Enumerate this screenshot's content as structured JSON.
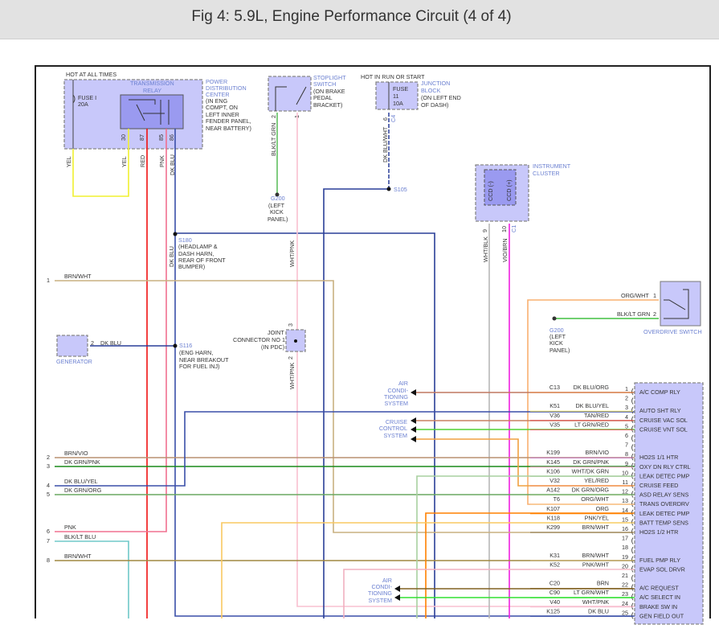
{
  "title": "Fig 4: 5.9L, Engine Performance Circuit (4 of 4)",
  "pdc": {
    "hot": "HOT AT ALL TIMES",
    "relay": [
      "TRANSMISSION",
      "RELAY"
    ],
    "fuse": [
      "FUSE I",
      "20A"
    ],
    "name": [
      "POWER",
      "DISTRIBUTION",
      "CENTER",
      "(IN ENG",
      "COMPT, ON",
      "LEFT INNER",
      "FENDER PANEL,",
      "NEAR BATTERY)"
    ],
    "pins": [
      "30",
      "87",
      "85",
      "86"
    ],
    "wires": [
      "YEL",
      "YEL",
      "RED",
      "PNK",
      "DK BLU"
    ]
  },
  "stoplight": {
    "name": [
      "STOPLIGHT",
      "SWITCH",
      "(ON BRAKE",
      "PEDAL",
      "BRACKET)"
    ],
    "pins": [
      "2",
      "1"
    ],
    "wires": [
      "BLK/LT GRN",
      "WHT/PNK"
    ],
    "ground": [
      "G200",
      "(LEFT",
      "KICK",
      "PANEL)"
    ]
  },
  "junction": {
    "hot": "HOT IN RUN OR START",
    "fuse": [
      "FUSE",
      "11",
      "10A"
    ],
    "name": [
      "JUNCTION",
      "BLOCK",
      "(ON LEFT END",
      "OF DASH)"
    ],
    "pin": "6",
    "conn": "C4",
    "wire": "DK BLU/WHT",
    "splice": "S105"
  },
  "cluster": {
    "name": [
      "INSTRUMENT",
      "CLUSTER"
    ],
    "ccd": [
      "CCD (-)",
      "CCD (+)"
    ],
    "pins": [
      "9",
      "10"
    ],
    "conn": "C1",
    "wires": [
      "WHT/BLK",
      "VIO/BRN"
    ]
  },
  "s180": {
    "name": [
      "S180",
      "(HEADLAMP &",
      "DASH HARN,",
      "REAR OF FRONT",
      "BUMPER)"
    ],
    "wire": "DK BLU"
  },
  "s116": {
    "name": [
      "S116",
      "(ENG HARN,",
      "NEAR BREAKOUT",
      "FOR FUEL INJ)"
    ]
  },
  "generator": {
    "name": "GENERATOR",
    "pin": "2",
    "wire": "DK BLU"
  },
  "joint": {
    "name": [
      "JOINT",
      "CONNECTOR NO 1",
      "(IN PDC)"
    ],
    "pins": [
      "3",
      "2"
    ],
    "wire": "WHT/PNK"
  },
  "overdrive": {
    "name": "OVERDRIVE SWITCH",
    "wires": [
      {
        "pin": "1",
        "label": "ORG/WHT"
      },
      {
        "pin": "2",
        "label": "BLK/LT GRN"
      }
    ],
    "ground": [
      "G200",
      "(LEFT",
      "KICK",
      "PANEL)"
    ]
  },
  "systems": {
    "ac1": [
      "AIR",
      "CONDI-",
      "TIONING",
      "SYSTEM"
    ],
    "cruise": [
      "CRUISE",
      "CONTROL",
      "SYSTEM"
    ],
    "ac2": [
      "AIR",
      "CONDI-",
      "TIONING",
      "SYSTEM"
    ]
  },
  "left_pins": [
    {
      "pin": "1",
      "label": "BRN/WHT"
    },
    {
      "pin": "2",
      "label": "BRN/VIO"
    },
    {
      "pin": "3",
      "label": "DK GRN/PNK"
    },
    {
      "pin": "4",
      "label": "DK BLU/YEL"
    },
    {
      "pin": "5",
      "label": "DK GRN/ORG"
    },
    {
      "pin": "6",
      "label": "PNK"
    },
    {
      "pin": "7",
      "label": "BLK/LT BLU"
    },
    {
      "pin": "8",
      "label": "BRN/WHT"
    }
  ],
  "pcm_pins": [
    {
      "pin": "1",
      "circuit": "C13",
      "wire": "DK BLU/ORG",
      "func": "A/C COMP RLY",
      "colors": [
        "#3a4fa8",
        "#e07a30"
      ]
    },
    {
      "pin": "2",
      "circuit": "",
      "wire": "",
      "func": ""
    },
    {
      "pin": "3",
      "circuit": "K51",
      "wire": "DK BLU/YEL",
      "func": "AUTO SHT RLY",
      "colors": [
        "#3a4fa8",
        "#f0e060"
      ]
    },
    {
      "pin": "4",
      "circuit": "V36",
      "wire": "TAN/RED",
      "func": "CRUISE VAC SOL",
      "colors": [
        "#c8a878",
        "#e05050"
      ]
    },
    {
      "pin": "5",
      "circuit": "V35",
      "wire": "LT GRN/RED",
      "func": "CRUISE VNT SOL",
      "colors": [
        "#50d030",
        "#e06060"
      ]
    },
    {
      "pin": "6",
      "circuit": "",
      "wire": "",
      "func": ""
    },
    {
      "pin": "7",
      "circuit": "",
      "wire": "",
      "func": ""
    },
    {
      "pin": "8",
      "circuit": "K199",
      "wire": "BRN/VIO",
      "func": "HO2S 1/1 HTR",
      "colors": [
        "#a07850",
        "#c070c0"
      ]
    },
    {
      "pin": "9",
      "circuit": "K145",
      "wire": "DK GRN/PNK",
      "func": "OXY DN RLY CTRL",
      "colors": [
        "#1a8a1a",
        "#f0a0c0"
      ]
    },
    {
      "pin": "10",
      "circuit": "K106",
      "wire": "WHT/DK GRN",
      "func": "LEAK DETEC PMP",
      "colors": [
        "#a8d0a0",
        "#a8d0a0"
      ]
    },
    {
      "pin": "11",
      "circuit": "V32",
      "wire": "YEL/RED",
      "func": "CRUISE FEED",
      "colors": [
        "#f0b020",
        "#f08040"
      ]
    },
    {
      "pin": "12",
      "circuit": "A142",
      "wire": "DK GRN/ORG",
      "func": "ASD RELAY SENS",
      "colors": [
        "#3a8a3a",
        "#a0c890"
      ]
    },
    {
      "pin": "13",
      "circuit": "T6",
      "wire": "ORG/WHT",
      "func": "TRANS OVERDRV",
      "colors": [
        "#f0a050",
        "#f8c890"
      ]
    },
    {
      "pin": "14",
      "circuit": "K107",
      "wire": "ORG",
      "func": "LEAK DETEC PMP",
      "colors": [
        "#ff8000",
        "#ff8000"
      ]
    },
    {
      "pin": "15",
      "circuit": "K118",
      "wire": "PNK/YEL",
      "func": "BATT TEMP SENS",
      "colors": [
        "#f8c060",
        "#f8d880"
      ]
    },
    {
      "pin": "16",
      "circuit": "K299",
      "wire": "BRN/WHT",
      "func": "HO2S 1/2 HTR",
      "colors": [
        "#8a7040",
        "#8a7040"
      ]
    },
    {
      "pin": "17",
      "circuit": "",
      "wire": "",
      "func": ""
    },
    {
      "pin": "18",
      "circuit": "",
      "wire": "",
      "func": ""
    },
    {
      "pin": "19",
      "circuit": "K31",
      "wire": "BRN/WHT",
      "func": "FUEL PMP RLY",
      "colors": [
        "#a08840",
        "#c8b070"
      ]
    },
    {
      "pin": "20",
      "circuit": "K52",
      "wire": "PNK/WHT",
      "func": "EVAP SOL DRVR",
      "colors": [
        "#f0b0c0",
        "#f8d0d8"
      ]
    },
    {
      "pin": "21",
      "circuit": "",
      "wire": "",
      "func": ""
    },
    {
      "pin": "22",
      "circuit": "C20",
      "wire": "BRN",
      "func": "A/C REQUEST",
      "colors": [
        "#806020",
        "#806020"
      ]
    },
    {
      "pin": "23",
      "circuit": "C90",
      "wire": "LT GRN/WHT",
      "func": "A/C SELECT IN",
      "colors": [
        "#30e030",
        "#30e030"
      ]
    },
    {
      "pin": "24",
      "circuit": "V40",
      "wire": "WHT/PNK",
      "func": "BRAKE SW IN",
      "colors": [
        "#f8c0d0",
        "#f8c0d0"
      ]
    },
    {
      "pin": "25",
      "circuit": "K125",
      "wire": "DK BLU",
      "func": "GEN FIELD OUT",
      "colors": [
        "#3a4fa8",
        "#3a4fa8"
      ]
    }
  ]
}
